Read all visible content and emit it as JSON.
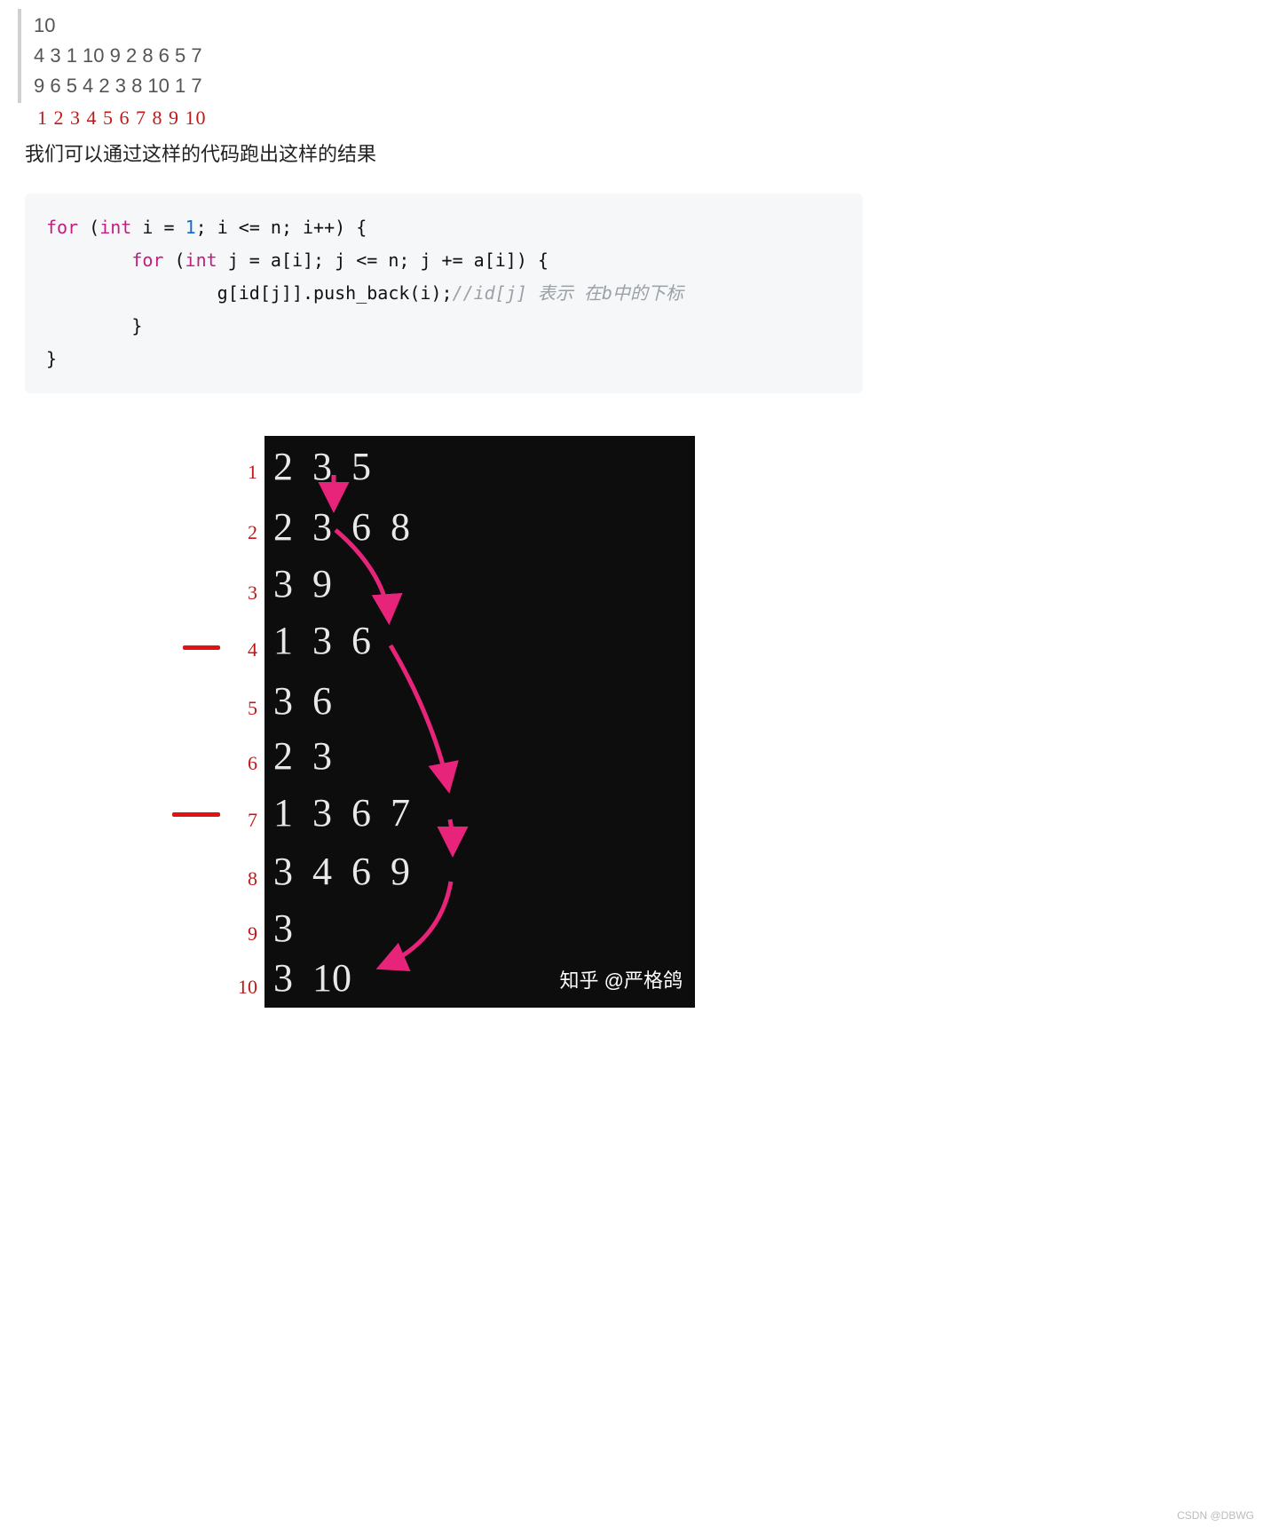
{
  "quote": {
    "line1": "10",
    "line2": "4 3 1 10 9 2 8 6 5 7",
    "line3": "9 6 5 4 2 3 8 10 1 7"
  },
  "red_index_line": "1 2 3 4 5 6 7 8 9 10",
  "body_para": "我们可以通过这样的代码跑出这样的结果",
  "code": {
    "l1a": "for",
    "l1b": " (",
    "l1c": "int",
    "l1d": " i = ",
    "l1e": "1",
    "l1f": "; i <= n; i++) {",
    "l2a": "        for",
    "l2b": " (",
    "l2c": "int",
    "l2d": " j = a[i]; j <= n; j += a[i]) {",
    "l3a": "                g[id[j]].push_back(i);",
    "l3b": "//id[j] 表示 在b中的下标",
    "l4": "        }",
    "l5": "}"
  },
  "term_rows": [
    [
      "2",
      "3",
      "5"
    ],
    [
      "2",
      "3",
      "6",
      "8"
    ],
    [
      "3",
      "9"
    ],
    [
      "1",
      "3",
      "6"
    ],
    [
      "3",
      "6"
    ],
    [
      "2",
      "3"
    ],
    [
      "1",
      "3",
      "6",
      "7"
    ],
    [
      "3",
      "4",
      "6",
      "9"
    ],
    [
      "3"
    ],
    [
      "3",
      "10"
    ]
  ],
  "row_labels": [
    "1",
    "2",
    "3",
    "4",
    "5",
    "6",
    "7",
    "8",
    "9",
    "10"
  ],
  "zhihu_watermark": "知乎 @严格鸽",
  "page_watermark": "CSDN @DBWG"
}
